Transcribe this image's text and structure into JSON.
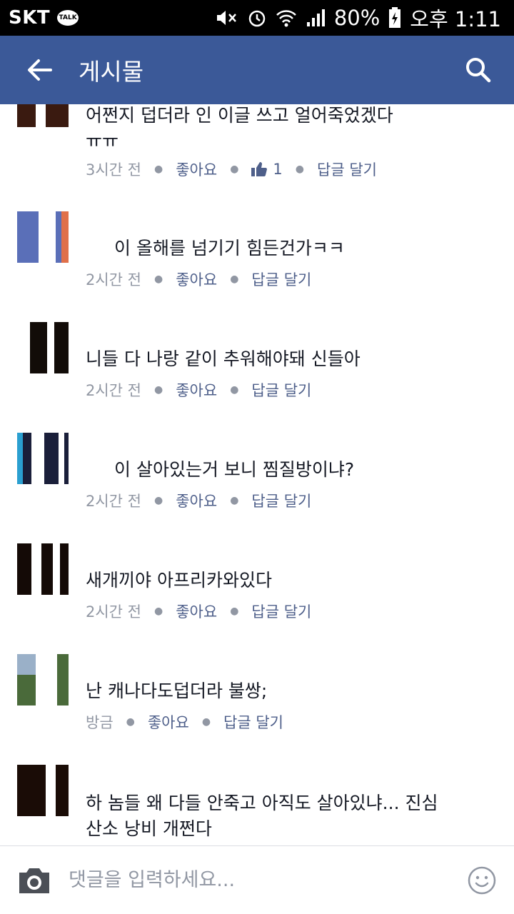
{
  "status_bar": {
    "carrier": "SKT",
    "talk_badge": "TALK",
    "battery": "80%",
    "time": "오후 1:11",
    "icons": [
      "kakaotalk-icon",
      "mute-icon",
      "alarm-icon",
      "wifi-icon",
      "signal-icon",
      "battery-charging-icon"
    ]
  },
  "toolbar": {
    "title": "게시물",
    "back_icon": "back-arrow-icon",
    "search_icon": "search-icon",
    "background": "#3b5998"
  },
  "comments": [
    {
      "text": "어쩐지 덥더라 인 이글 쓰고 얼어죽었겠다",
      "text_line2": "ㅠㅠ",
      "time": "3시간 전",
      "like": "좋아요",
      "like_count": "1",
      "reply": "답글 달기"
    },
    {
      "text": "이 올해를 넘기기 힘든건가ㅋㅋ",
      "time": "2시간 전",
      "like": "좋아요",
      "reply": "답글 달기"
    },
    {
      "text": "니들 다 나랑 같이 추워해야돼 신들아",
      "time": "2시간 전",
      "like": "좋아요",
      "reply": "답글 달기"
    },
    {
      "text": "이 살아있는거 보니 찜질방이냐?",
      "time": "2시간 전",
      "like": "좋아요",
      "reply": "답글 달기"
    },
    {
      "text": "새개끼야 아프리카와있다",
      "time": "2시간 전",
      "like": "좋아요",
      "reply": "답글 달기"
    },
    {
      "text": "난 캐나다도덥더라 불쌍;",
      "time": "방금",
      "like": "좋아요",
      "reply": "답글 달기"
    },
    {
      "text": "하 놈들 왜 다들 안죽고 아직도 살아있냐... 진심",
      "text_line2": "산소 낭비 개쩐다"
    }
  ],
  "compose": {
    "placeholder": "댓글을 입력하세요...",
    "camera_icon": "camera-icon",
    "emoji_icon": "emoji-icon"
  },
  "colors": {
    "accent": "#3b5998",
    "link": "#4e5f8a",
    "muted": "#9197a3",
    "text": "#141823"
  }
}
